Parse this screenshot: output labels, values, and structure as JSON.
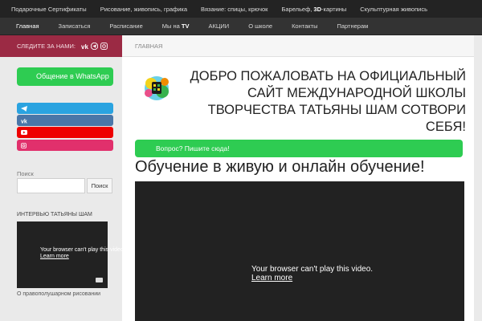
{
  "topbar": {
    "items": [
      "Подарочные Сертификаты",
      "Рисование, живопись, графика",
      "Вязание: спицы, крючок",
      "Барельеф, ",
      "3D",
      "-картины",
      "Скульптурная живопись"
    ]
  },
  "nav": {
    "items": [
      "Главная",
      "Записаться",
      "Расписание",
      "Мы на ",
      "TV",
      "АКЦИИ",
      "О школе",
      "Контакты",
      "Партнерам"
    ]
  },
  "social": {
    "label": "СЛЕДИТЕ ЗА НАМИ:",
    "icons": [
      "vk-icon",
      "telegram-icon",
      "instagram-icon"
    ]
  },
  "breadcrumb": {
    "current": "ГЛАВНАЯ"
  },
  "sidebar": {
    "whatsapp_label": "Общение в WhatsApp",
    "social_buttons": [
      {
        "icon": "telegram-icon",
        "color": "#2aa3e0"
      },
      {
        "icon": "vk-icon",
        "color": "#4a76a8"
      },
      {
        "icon": "youtube-icon",
        "color": "#ee0000"
      },
      {
        "icon": "instagram-icon",
        "color": "#e1306c"
      }
    ],
    "search_label": "Поиск",
    "search_value": "",
    "search_button": "Поиск",
    "interview_label": "ИНТЕРВЬЮ ТАТЬЯНЫ ШАМ",
    "video_msg": "Your browser can't play this video.",
    "video_link": "Learn more",
    "video_caption": "О правополушарном рисовании"
  },
  "main": {
    "welcome": "ДОБРО ПОЖАЛОВАТЬ НА ОФИЦИАЛЬНЫЙ САЙТ МЕЖДУНАРОДНОЙ ШКОЛЫ ТВОРЧЕСТВА ТАТЬЯНЫ ШАМ СОТВОРИ СЕБЯ!",
    "question_btn": "Вопрос? Пишите сюда!",
    "heading": "Обучение в живую и онлайн обучение!",
    "video_msg": "Your browser can't play this video.",
    "video_link": "Learn more"
  },
  "colors": {
    "accent_green": "#2ecc52",
    "brand_red": "#9b2a44",
    "topbar_bg": "#232323"
  }
}
